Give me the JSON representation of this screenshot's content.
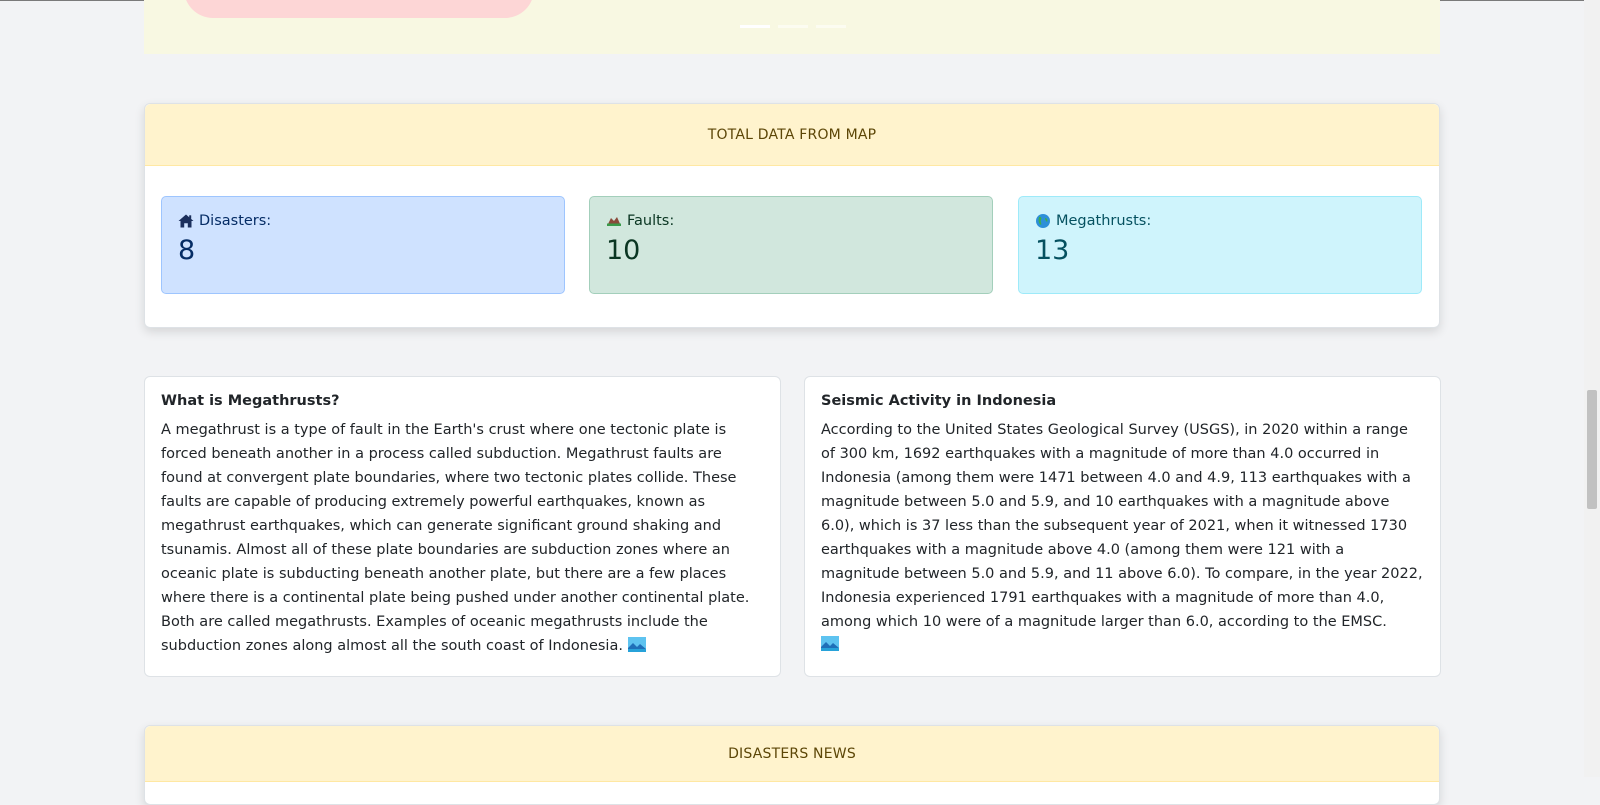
{
  "total_data": {
    "header": "TOTAL DATA FROM MAP",
    "stats": [
      {
        "label": "Disasters:",
        "value": "8",
        "icon": "house-icon"
      },
      {
        "label": "Faults:",
        "value": "10",
        "icon": "mountain-icon"
      },
      {
        "label": "Megathrusts:",
        "value": "13",
        "icon": "globe-icon"
      }
    ]
  },
  "megathrusts": {
    "title": "What is Megathrusts?",
    "body": "A megathrust is a type of fault in the Earth's crust where one tectonic plate is forced beneath another in a process called subduction. Megathrust faults are found at convergent plate boundaries, where two tectonic plates collide. These faults are capable of producing extremely powerful earthquakes, known as megathrust earthquakes, which can generate significant ground shaking and tsunamis. Almost all of these plate boundaries are subduction zones where an oceanic plate is subducting beneath another plate, but there are a few places where there is a continental plate being pushed under another continental plate. Both are called megathrusts. Examples of oceanic megathrusts include the subduction zones along almost all the south coast of Indonesia."
  },
  "seismic": {
    "title": "Seismic Activity in Indonesia",
    "body": "According to the United States Geological Survey (USGS), in 2020 within a range of 300 km, 1692 earthquakes with a magnitude of more than 4.0 occurred in Indonesia (among them were 1471 between 4.0 and 4.9, 113 earthquakes with a magnitude between 5.0 and 5.9, and 10 earthquakes with a magnitude above 6.0), which is 37 less than the subsequent year of 2021, when it witnessed 1730 earthquakes with a magnitude above 4.0 (among them were 121 with a magnitude between 5.0 and 5.9, and 11 above 6.0). To compare, in the year 2022, Indonesia experienced 1791 earthquakes with a magnitude of more than 4.0, among which 10 were of a magnitude larger than 6.0, according to the EMSC."
  },
  "news": {
    "header": "DISASTERS NEWS"
  },
  "carousel": {
    "indicator_count": 3,
    "active_index": 0
  }
}
